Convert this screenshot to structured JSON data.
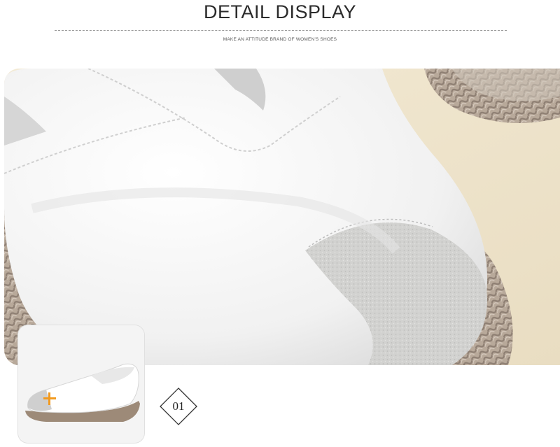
{
  "header": {
    "title": "DETAIL DISPLAY",
    "subtitle": "MAKE AN ATTITUDE BRAND OF WOMEN'S SHOES"
  },
  "hero_image": {
    "description_icon": "shoe-toe-closeup"
  },
  "thumbnail": {
    "icon": "plus-icon",
    "accent_color": "#f29a1f"
  },
  "detail_badge": {
    "label": "01"
  }
}
